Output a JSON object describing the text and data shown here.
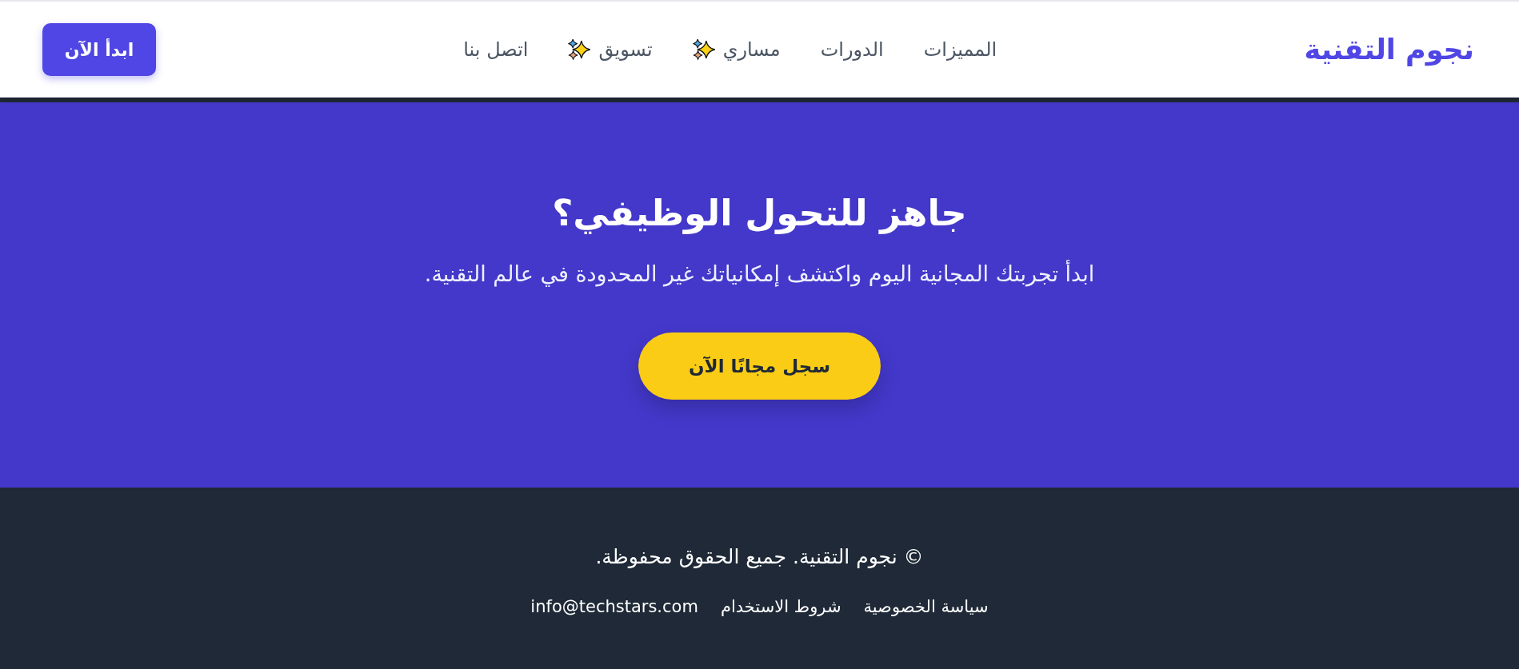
{
  "header": {
    "logo": "نجوم التقنية",
    "nav": [
      {
        "label": "المميزات",
        "kind": "plain"
      },
      {
        "label": "الدورات",
        "kind": "plain"
      },
      {
        "label": "مساري",
        "kind": "featured"
      },
      {
        "label": "تسويق",
        "kind": "featured"
      },
      {
        "label": "اتصل بنا",
        "kind": "plain"
      }
    ],
    "cta": "ابدأ الآن"
  },
  "hero": {
    "title": "جاهز للتحول الوظيفي؟",
    "subtitle": "ابدأ تجربتك المجانية اليوم واكتشف إمكانياتك غير المحدودة في عالم التقنية.",
    "button": "سجل مجانًا الآن"
  },
  "footer": {
    "copyright": "© نجوم التقنية. جميع الحقوق محفوظة.",
    "links": [
      "سياسة الخصوصية",
      "شروط الاستخدام",
      "info@techstars.com"
    ]
  }
}
